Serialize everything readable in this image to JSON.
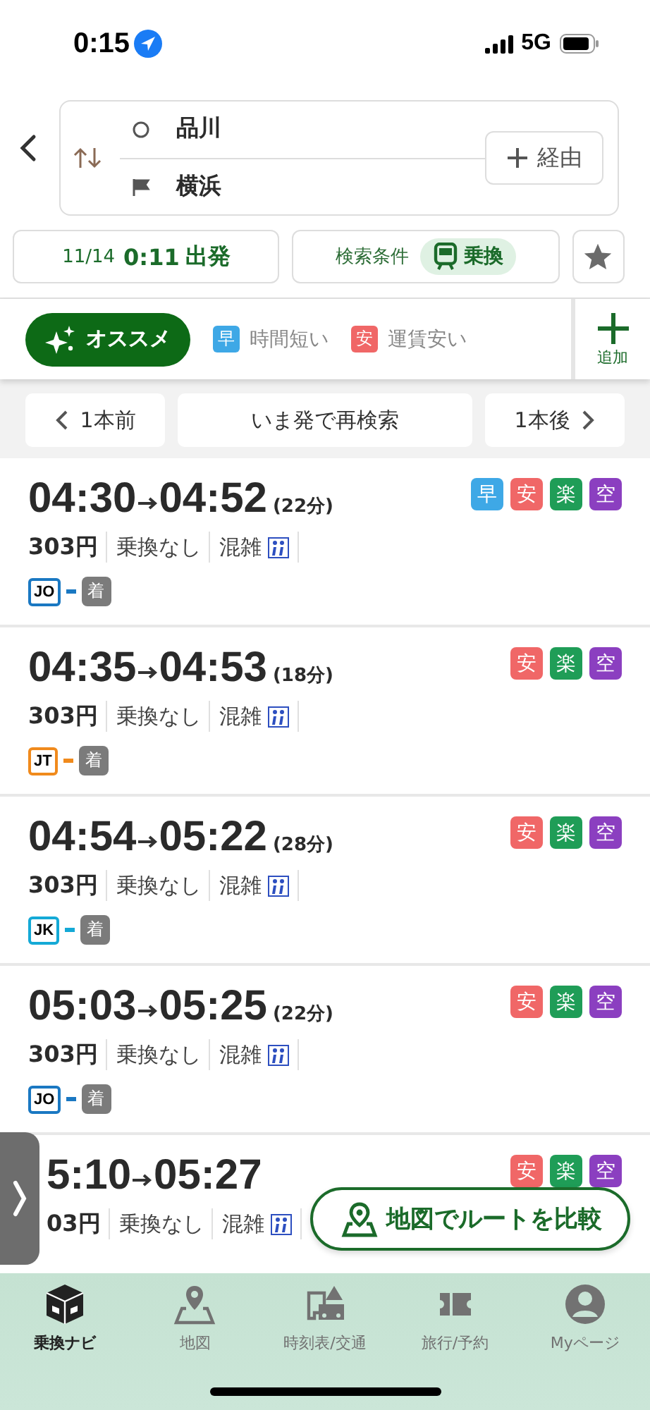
{
  "status_bar": {
    "time": "0:15",
    "network": "5G"
  },
  "header": {
    "from": "品川",
    "to": "横浜",
    "via_button": "経由"
  },
  "conditions": {
    "date": "11/14",
    "time": "0:11",
    "mode": "出発",
    "label": "検索条件",
    "chip": "乗換"
  },
  "filters": [
    {
      "label": "オススメ",
      "selected": true
    },
    {
      "badge": "早",
      "color": "#3ea8e6",
      "label": "時間短い",
      "selected": false
    },
    {
      "badge": "安",
      "color": "#f06767",
      "label": "運賃安い",
      "selected": false
    }
  ],
  "add_button": "追加",
  "nav": {
    "prev": "1本前",
    "research": "いま発で再検索",
    "next": "1本後"
  },
  "routes": [
    {
      "kind": "full",
      "depart": "04:30",
      "arrive": "04:52",
      "duration": "(22分)",
      "tags": [
        {
          "label": "早",
          "color": "#3ea8e6"
        },
        {
          "label": "安",
          "color": "#f06767"
        },
        {
          "label": "楽",
          "color": "#1f9d57"
        },
        {
          "label": "空",
          "color": "#8b3fc0"
        }
      ],
      "fare": "303円",
      "transfers": "乗換なし",
      "crowd": "混雑",
      "line": {
        "code": "JO",
        "color": "#1a78c2"
      },
      "arrival_badge": "着"
    },
    {
      "kind": "full",
      "depart": "04:35",
      "arrive": "04:53",
      "duration": "(18分)",
      "tags": [
        {
          "label": "安",
          "color": "#f06767"
        },
        {
          "label": "楽",
          "color": "#1f9d57"
        },
        {
          "label": "空",
          "color": "#8b3fc0"
        }
      ],
      "fare": "303円",
      "transfers": "乗換なし",
      "crowd": "混雑",
      "line": {
        "code": "JT",
        "color": "#f08a1c"
      },
      "arrival_badge": "着"
    },
    {
      "kind": "full",
      "depart": "04:54",
      "arrive": "05:22",
      "duration": "(28分)",
      "tags": [
        {
          "label": "安",
          "color": "#f06767"
        },
        {
          "label": "楽",
          "color": "#1f9d57"
        },
        {
          "label": "空",
          "color": "#8b3fc0"
        }
      ],
      "fare": "303円",
      "transfers": "乗換なし",
      "crowd": "混雑",
      "line": {
        "code": "JK",
        "color": "#14a9d6"
      },
      "arrival_badge": "着"
    },
    {
      "kind": "full",
      "depart": "05:03",
      "arrive": "05:25",
      "duration": "(22分)",
      "tags": [
        {
          "label": "安",
          "color": "#f06767"
        },
        {
          "label": "楽",
          "color": "#1f9d57"
        },
        {
          "label": "空",
          "color": "#8b3fc0"
        }
      ],
      "fare": "303円",
      "transfers": "乗換なし",
      "crowd": "混雑",
      "line": {
        "code": "JO",
        "color": "#1a78c2"
      },
      "arrival_badge": "着"
    },
    {
      "kind": "partial",
      "depart": "5:10",
      "arrive": "05:27",
      "tags": [
        {
          "label": "安",
          "color": "#f06767"
        },
        {
          "label": "楽",
          "color": "#1f9d57"
        },
        {
          "label": "空",
          "color": "#8b3fc0"
        }
      ],
      "fare": "03円",
      "transfers": "乗換なし",
      "crowd": "混雑"
    }
  ],
  "map_button": "地図でルートを比較",
  "tab_bar": [
    {
      "label": "乗換ナビ",
      "selected": true
    },
    {
      "label": "地図",
      "selected": false
    },
    {
      "label": "時刻表/交通",
      "selected": false
    },
    {
      "label": "旅行/予約",
      "selected": false
    },
    {
      "label": "Myページ",
      "selected": false
    }
  ]
}
